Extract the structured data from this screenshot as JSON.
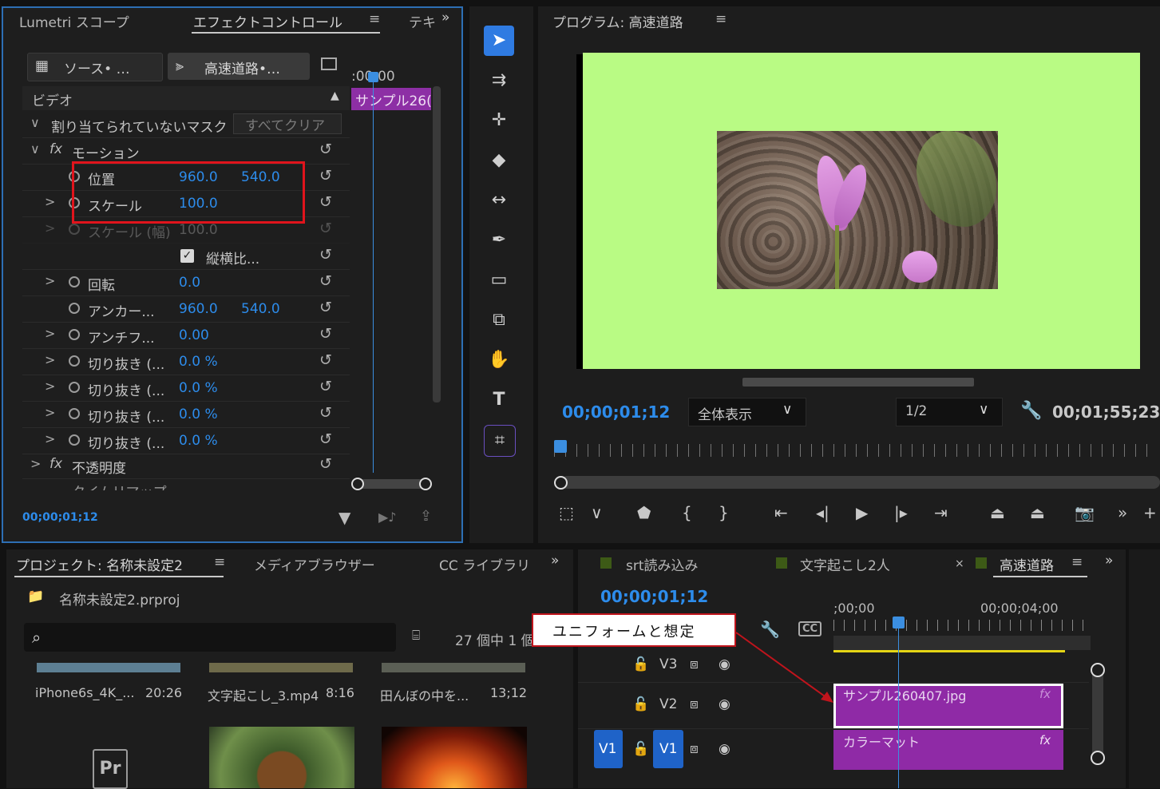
{
  "effect_panel": {
    "tabs": [
      "Lumetri スコープ",
      "エフェクトコントロール",
      "テキ"
    ],
    "source_tab": "ソース• …",
    "sequence_tab": "高速道路•…",
    "timecode_ruler": ":00;00",
    "clip_label": "サンプル26(",
    "section_video": "ビデオ",
    "mask_row": "割り当てられていないマスク",
    "clear_all": "すべてクリア",
    "motion": "モーション",
    "fx": "fx",
    "rows": [
      {
        "label": "位置",
        "v1": "960.0",
        "v2": "540.0"
      },
      {
        "label": "スケール",
        "v1": "100.0",
        "v2": ""
      },
      {
        "label": "スケール (幅)",
        "v1": "100.0",
        "v2": ""
      },
      {
        "label": "縦横比...",
        "v1": "",
        "v2": ""
      },
      {
        "label": "回転",
        "v1": "0.0",
        "v2": ""
      },
      {
        "label": "アンカー...",
        "v1": "960.0",
        "v2": "540.0"
      },
      {
        "label": "アンチフ...",
        "v1": "0.00",
        "v2": ""
      },
      {
        "label": "切り抜き (...",
        "v1": "0.0 %",
        "v2": ""
      },
      {
        "label": "切り抜き (...",
        "v1": "0.0 %",
        "v2": ""
      },
      {
        "label": "切り抜き (...",
        "v1": "0.0 %",
        "v2": ""
      },
      {
        "label": "切り抜き (...",
        "v1": "0.0 %",
        "v2": ""
      }
    ],
    "opacity": "不透明度",
    "timeremap": "タイムリマップ",
    "timecode": "00;00;01;12"
  },
  "program": {
    "title": "プログラム: 高速道路",
    "timecode": "00;00;01;12",
    "zoom": "全体表示",
    "resolution": "1/2",
    "duration": "00;01;55;23",
    "frame_bg": "#b9fb84"
  },
  "project": {
    "tabs": [
      "プロジェクト: 名称未設定2",
      "メディアブラウザー",
      "CC ライブラリ"
    ],
    "file": "名称未設定2.prproj",
    "count": "27 個中 1 個",
    "items": [
      {
        "name": "iPhone6s_4K_...",
        "dur": "20:26"
      },
      {
        "name": "文字起こし_3.mp4",
        "dur": "8:16"
      },
      {
        "name": "田んぼの中を...",
        "dur": "13;12"
      }
    ]
  },
  "timeline": {
    "tabs": [
      "srt読み込み",
      "文字起こし2人",
      "高速道路"
    ],
    "timecode": "00;00;01;12",
    "ruler_start": ";00;00",
    "ruler_mid": "00;00;04;00",
    "tracks": [
      "V3",
      "V2",
      "V1"
    ],
    "source_patch": "V1",
    "clip_v2": "サンプル260407.jpg",
    "clip_v1": "カラーマット",
    "fx": "fx"
  },
  "callout": "ユニフォームと想定"
}
